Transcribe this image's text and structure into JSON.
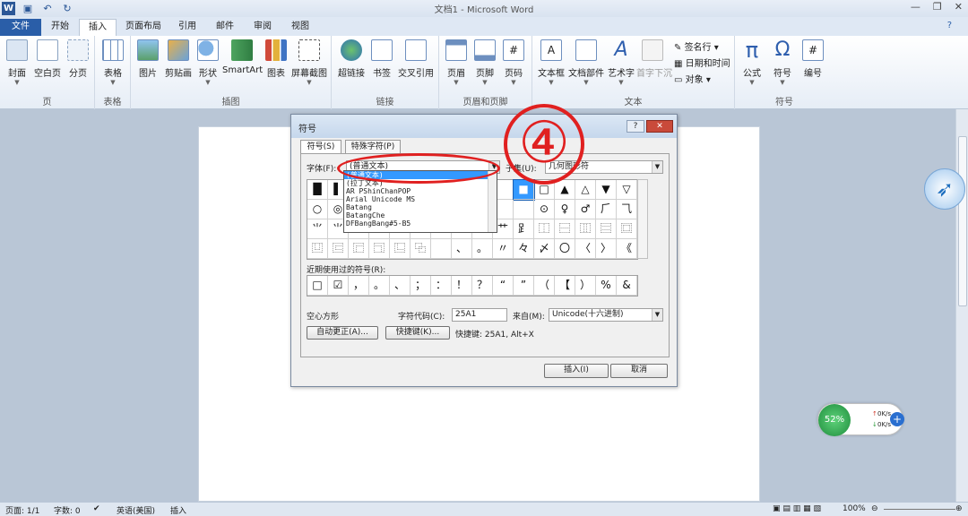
{
  "window": {
    "title": "文档1 - Microsoft Word"
  },
  "qat": {
    "logo": "W",
    "icons": [
      "save-icon",
      "undo-icon",
      "redo-icon"
    ]
  },
  "tabs": [
    "文件",
    "开始",
    "插入",
    "页面布局",
    "引用",
    "邮件",
    "审阅",
    "视图"
  ],
  "ribbon": {
    "groups": {
      "pages": "页",
      "tables": "表格",
      "illustrations": "插图",
      "links": "链接",
      "header_footer": "页眉和页脚",
      "text": "文本",
      "symbols": "符号"
    },
    "buttons": {
      "cover": "封面",
      "blank": "空白页",
      "pagebreak": "分页",
      "table": "表格",
      "picture": "图片",
      "clipart": "剪贴画",
      "shapes": "形状",
      "smartart": "SmartArt",
      "chart": "图表",
      "screenshot": "屏幕截图",
      "hyperlink": "超链接",
      "bookmark": "书签",
      "crossref": "交叉引用",
      "header": "页眉",
      "footer": "页脚",
      "pagenum": "页码",
      "textbox": "文本框",
      "quickparts": "文档部件",
      "wordart": "艺术字",
      "dropcap": "首字下沉",
      "signature": "签名行",
      "datetime": "日期和时间",
      "object": "对象",
      "equation": "公式",
      "symbol": "符号",
      "number": "编号"
    }
  },
  "dialog": {
    "title": "符号",
    "tab_symbols": "符号(S)",
    "tab_special": "特殊字符(P)",
    "font_label": "字体(F):",
    "font_value": "(普通文本)",
    "subset_label": "子集(U):",
    "subset_value": "几何图形符",
    "font_list": [
      "(普通文本)",
      "(拉丁文本)",
      "AR PShinChanPOP",
      "Arial Unicode MS",
      "Batang",
      "BatangChe",
      "DFBangBang#5-B5"
    ],
    "grid": [
      [
        "█",
        "▌",
        "",
        "",
        "",
        "",
        "",
        "",
        "",
        "",
        "■",
        "□",
        "▲",
        "△",
        "▼",
        "▽",
        "◆",
        "◇"
      ],
      [
        "○",
        "◎",
        "",
        "",
        "",
        "",
        "",
        "",
        "",
        "",
        "",
        "⊙",
        "♀",
        "♂",
        "⺁",
        "⺄",
        "⺇",
        "⺈"
      ],
      [
        "⺌",
        "⺌",
        "",
        "",
        "",
        "",
        "",
        "",
        "",
        "⺾",
        "⻊",
        "⿰",
        "⿱",
        "⿲",
        "⿳",
        "⿴",
        "⿵"
      ],
      [
        "⿶",
        "⿷",
        "⿸",
        "⿹",
        "⿺",
        "⿻",
        "",
        "、",
        "。",
        "〃",
        "々",
        "〆",
        "〇",
        "〈",
        "〉",
        "《"
      ]
    ],
    "recent_label": "近期使用过的符号(R):",
    "recent": [
      "□",
      "☑",
      "，",
      "。",
      "、",
      "；",
      "：",
      "！",
      "？",
      "“",
      "”",
      "（",
      "【",
      "）",
      "%",
      "&"
    ],
    "char_name": "空心方形",
    "code_label": "字符代码(C):",
    "code_value": "25A1",
    "from_label": "来自(M):",
    "from_value": "Unicode(十六进制)",
    "autocorrect": "自动更正(A)...",
    "shortcut_btn": "快捷键(K)...",
    "shortcut_text": "快捷键: 25A1, Alt+X",
    "insert": "插入(I)",
    "cancel": "取消",
    "help": "?",
    "close": "✕"
  },
  "annotation": {
    "step": "④"
  },
  "status": {
    "page": "页面: 1/1",
    "words": "字数: 0",
    "language": "英语(美国)",
    "mode": "插入",
    "zoom": "100%"
  },
  "speed_widget": {
    "percent": "52%",
    "up": "0K/s",
    "down": "0K/s",
    "plus": "+"
  },
  "colors": {
    "file_tab": "#2a5ea8",
    "annotation": "#e02020",
    "selection": "#3399ff"
  }
}
